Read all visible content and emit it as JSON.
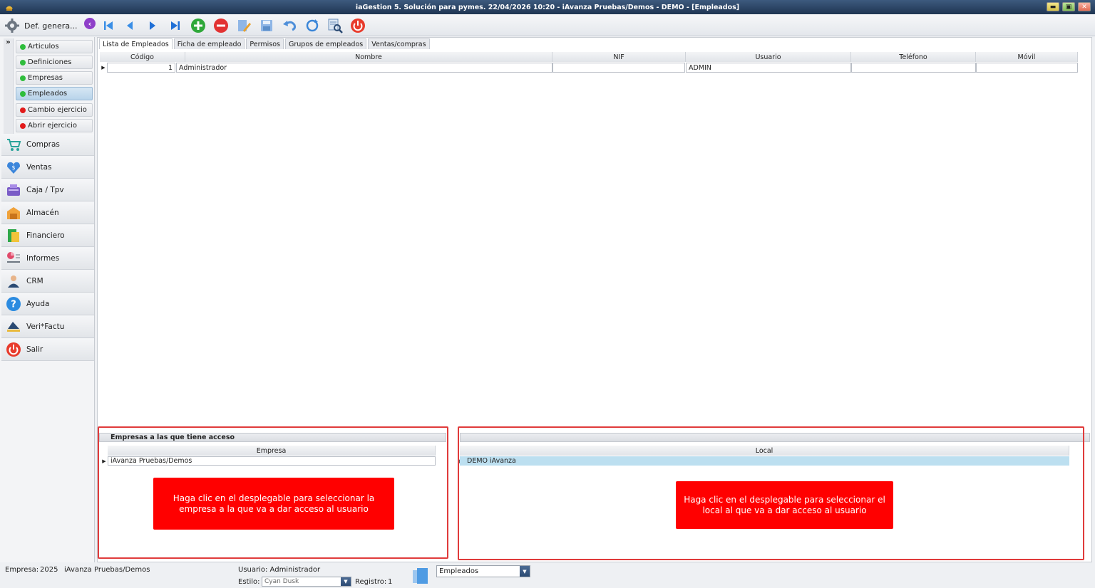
{
  "window": {
    "title": "iaGestion 5. Solución para pymes.   22/04/2026 10:20   -   iAvanza Pruebas/Demos - DEMO - [Empleados]"
  },
  "toolbar": {
    "def_label": "Def. genera..."
  },
  "sidebar": {
    "sub_items": [
      {
        "label": "Articulos",
        "status": "green"
      },
      {
        "label": "Definiciones",
        "status": "green"
      },
      {
        "label": "Empresas",
        "status": "green"
      },
      {
        "label": "Empleados",
        "status": "green",
        "active": true
      },
      {
        "label": "Cambio ejercicio",
        "status": "red"
      },
      {
        "label": "Abrir ejercicio",
        "status": "red"
      }
    ],
    "modules": [
      {
        "label": "Compras",
        "icon": "cart-icon"
      },
      {
        "label": "Ventas",
        "icon": "sales-icon"
      },
      {
        "label": "Caja / Tpv",
        "icon": "cash-register-icon"
      },
      {
        "label": "Almacén",
        "icon": "warehouse-icon"
      },
      {
        "label": "Financiero",
        "icon": "finance-icon"
      },
      {
        "label": "Informes",
        "icon": "reports-icon"
      },
      {
        "label": "CRM",
        "icon": "crm-user-icon"
      },
      {
        "label": "Ayuda",
        "icon": "help-icon"
      },
      {
        "label": "Veri*Factu",
        "icon": "verifactu-icon"
      },
      {
        "label": "Salir",
        "icon": "power-icon"
      }
    ]
  },
  "tabs": [
    "Lista de Empleados",
    "Ficha de empleado",
    "Permisos",
    "Grupos de empleados",
    "Ventas/compras"
  ],
  "grid": {
    "columns": [
      "Código",
      "Nombre",
      "NIF",
      "Usuario",
      "Teléfono",
      "Móvil"
    ],
    "rows": [
      {
        "codigo": "1",
        "nombre": "Administrador",
        "nif": "",
        "usuario": "ADMIN",
        "telefono": "",
        "movil": ""
      }
    ]
  },
  "empresas_panel": {
    "title": "Empresas a las que tiene acceso",
    "column": "Empresa",
    "rows": [
      "iAvanza Pruebas/Demos"
    ],
    "hint": "Haga clic en el desplegable para seleccionar la empresa a la que va a dar acceso al usuario"
  },
  "local_panel": {
    "column": "Local",
    "rows": [
      "DEMO iAvanza"
    ],
    "hint": "Haga clic en el desplegable para seleccionar el local al que va a dar acceso al usuario"
  },
  "status": {
    "empresa_label": "Empresa:",
    "empresa_year": "2025",
    "empresa_name": "iAvanza Pruebas/Demos",
    "usuario": "Usuario: Administrador",
    "estilo_label": "Estilo:",
    "estilo_value": "Cyan Dusk",
    "registro_label": "Registro:",
    "registro_value": "1",
    "module_value": "Empleados"
  },
  "colors": {
    "accent_red": "#ff0000",
    "frame_red": "#e03b3b",
    "title_bar": "#2b4466",
    "active_green": "#2fbd3c"
  }
}
